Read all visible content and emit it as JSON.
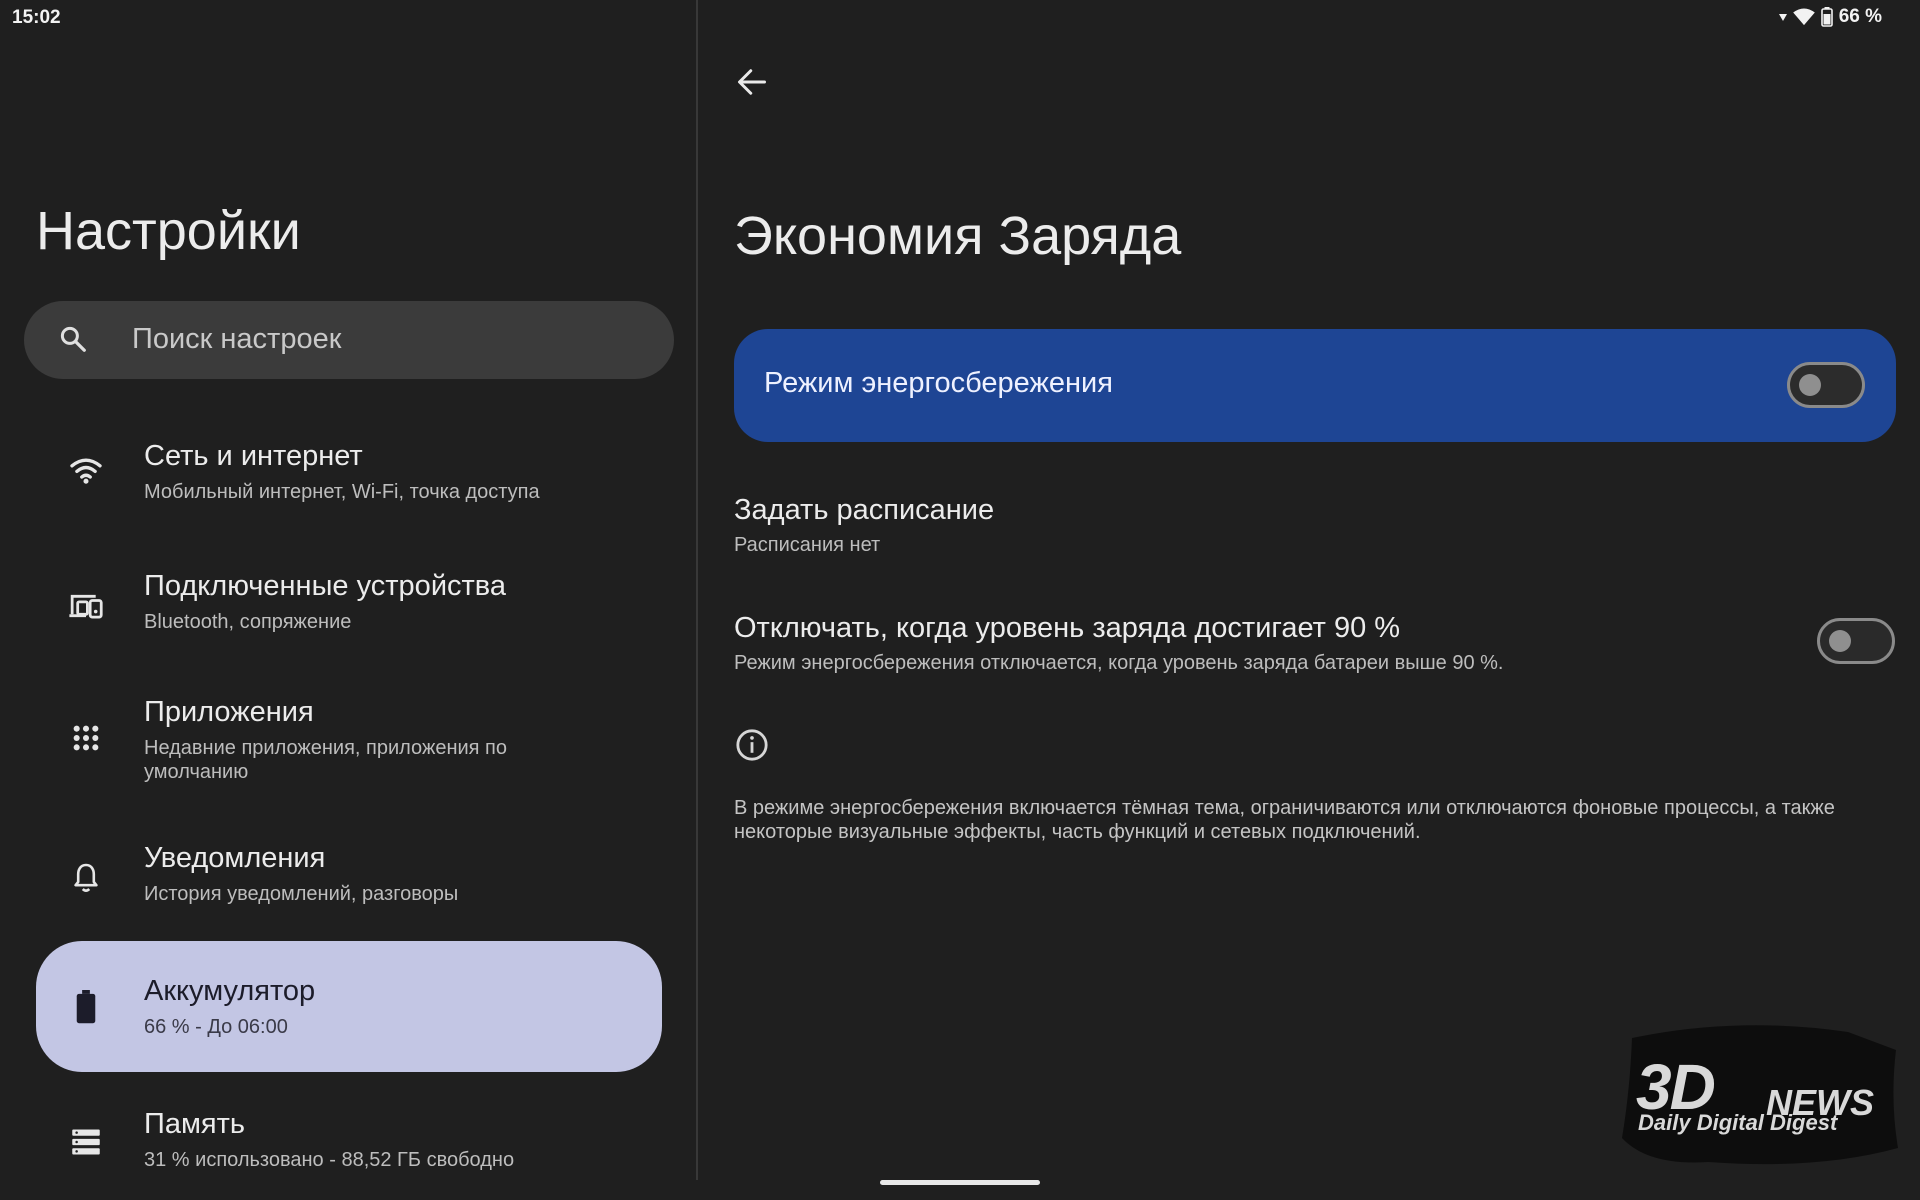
{
  "status_bar": {
    "time": "15:02",
    "battery_text": "66 %",
    "icons": [
      "signal-arrow-icon",
      "wifi-icon",
      "battery-icon"
    ]
  },
  "left_pane": {
    "title": "Настройки",
    "search": {
      "placeholder": "Поиск настроек"
    },
    "items": [
      {
        "icon": "wifi-icon",
        "title": "Сеть и интернет",
        "subtitle": "Мобильный интернет, Wi-Fi, точка доступа"
      },
      {
        "icon": "devices-icon",
        "title": "Подключенные устройства",
        "subtitle": "Bluetooth, сопряжение"
      },
      {
        "icon": "apps-grid-icon",
        "title": "Приложения",
        "subtitle": "Недавние приложения, приложения по умолчанию"
      },
      {
        "icon": "bell-icon",
        "title": "Уведомления",
        "subtitle": "История уведомлений, разговоры"
      },
      {
        "icon": "battery-icon",
        "title": "Аккумулятор",
        "subtitle": "66 % - До 06:00",
        "active": true
      },
      {
        "icon": "storage-icon",
        "title": "Память",
        "subtitle": "31 % использовано - 88,52 ГБ свободно"
      }
    ]
  },
  "right_pane": {
    "title": "Экономия Заряда",
    "primary_switch": {
      "label": "Режим энергосбережения",
      "on": false
    },
    "schedule": {
      "title": "Задать расписание",
      "subtitle": "Расписания нет"
    },
    "auto_off": {
      "title": "Отключать, когда уровень заряда достигает 90 %",
      "subtitle": "Режим энергосбережения отключается, когда уровень заряда батареи выше 90 %.",
      "on": false
    },
    "info_text": "В режиме энергосбережения включается тёмная тема, ограничиваются или отключаются фоновые процессы, а также некоторые визуальные эффекты, часть функций и сетевых подключений."
  },
  "watermark": {
    "logo": "3D",
    "news": "NEWS",
    "tagline": "Daily Digital Digest"
  },
  "colors": {
    "background": "#1f1f1f",
    "primary_card": "#1e4594",
    "active_item": "#c3c6e4",
    "search_bg": "#3b3b3b"
  }
}
